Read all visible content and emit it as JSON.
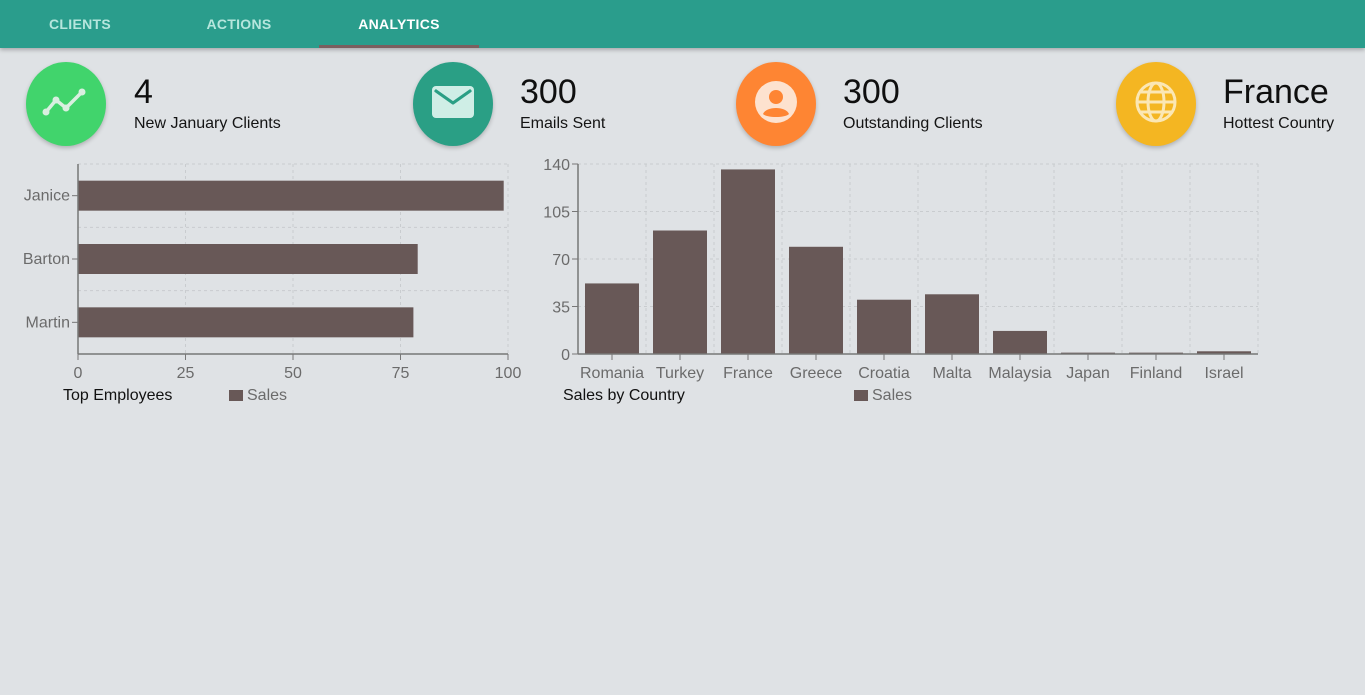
{
  "nav": {
    "tabs": [
      {
        "label": "CLIENTS",
        "active": false
      },
      {
        "label": "ACTIONS",
        "active": false
      },
      {
        "label": "ANALYTICS",
        "active": true
      }
    ]
  },
  "stats": [
    {
      "value": "4",
      "label": "New January Clients",
      "icon": "trending-line-icon",
      "color": "#41d46c"
    },
    {
      "value": "300",
      "label": "Emails Sent",
      "icon": "envelope-icon",
      "color": "#2a9f85"
    },
    {
      "value": "300",
      "label": "Outstanding Clients",
      "icon": "account-circle-icon",
      "color": "#fe8533"
    },
    {
      "value": "France",
      "label": "Hottest Country",
      "icon": "globe-icon",
      "color": "#f4b622"
    }
  ],
  "colors": {
    "bar": "#685857",
    "grid": "#c9cccf",
    "axis": "#777777",
    "tick_text": "#6b6b6b"
  },
  "chart_data": [
    {
      "type": "bar",
      "orientation": "horizontal",
      "title": "Top Employees",
      "categories": [
        "Janice",
        "Barton",
        "Martin"
      ],
      "series": [
        {
          "name": "Sales",
          "values": [
            99,
            79,
            78
          ]
        }
      ],
      "xlim": [
        0,
        100
      ],
      "xticks": [
        "0",
        "25",
        "50",
        "75",
        "100"
      ],
      "grid": true,
      "legend": "bottom"
    },
    {
      "type": "bar",
      "title": "Sales by Country",
      "categories": [
        "Romania",
        "Turkey",
        "France",
        "Greece",
        "Croatia",
        "Malta",
        "Malaysia",
        "Japan",
        "Finland",
        "Israel"
      ],
      "series": [
        {
          "name": "Sales",
          "values": [
            52,
            91,
            136,
            79,
            40,
            44,
            17,
            1,
            1,
            2
          ]
        }
      ],
      "ylim": [
        0,
        140
      ],
      "yticks": [
        "0",
        "35",
        "70",
        "105",
        "140"
      ],
      "grid": true,
      "legend": "bottom"
    }
  ]
}
